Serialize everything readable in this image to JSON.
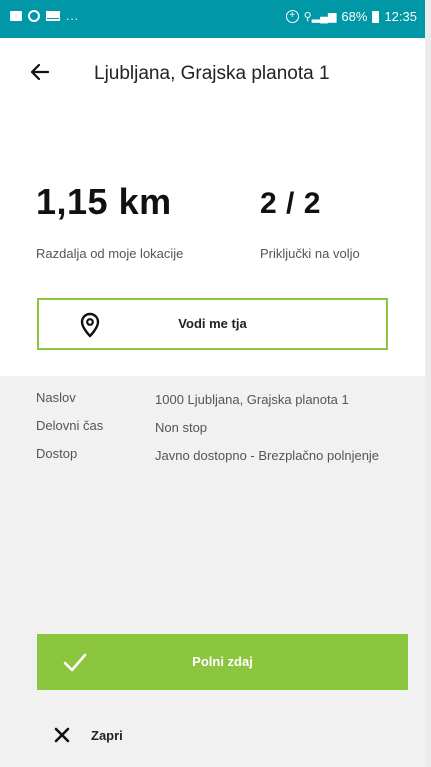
{
  "statusbar": {
    "left_icons": [
      "gallery-icon",
      "ring-icon",
      "mail-icon"
    ],
    "dots": "...",
    "battery": "68%",
    "time": "12:35"
  },
  "appbar": {
    "title": "Ljubljana, Grajska planota 1"
  },
  "stats": {
    "distance": {
      "value": "1,15 km",
      "label": "Razdalja od moje lokacije"
    },
    "connectors": {
      "value": "2 / 2",
      "label": "Priključki na voljo"
    }
  },
  "navigate_button": {
    "label": "Vodi me tja",
    "icon": "map-pin-icon"
  },
  "details": [
    {
      "key": "Naslov",
      "value": "1000 Ljubljana, Grajska planota 1"
    },
    {
      "key": "Delovni čas",
      "value": "Non stop"
    },
    {
      "key": "Dostop",
      "value": "Javno dostopno - Brezplačno polnjenje"
    }
  ],
  "charge_button": {
    "label": "Polni zdaj",
    "icon": "check-icon"
  },
  "close_button": {
    "label": "Zapri",
    "icon": "close-icon"
  },
  "colors": {
    "statusbar": "#0097a7",
    "accent_green": "#8cc63f",
    "details_bg": "#f1f1f1"
  }
}
